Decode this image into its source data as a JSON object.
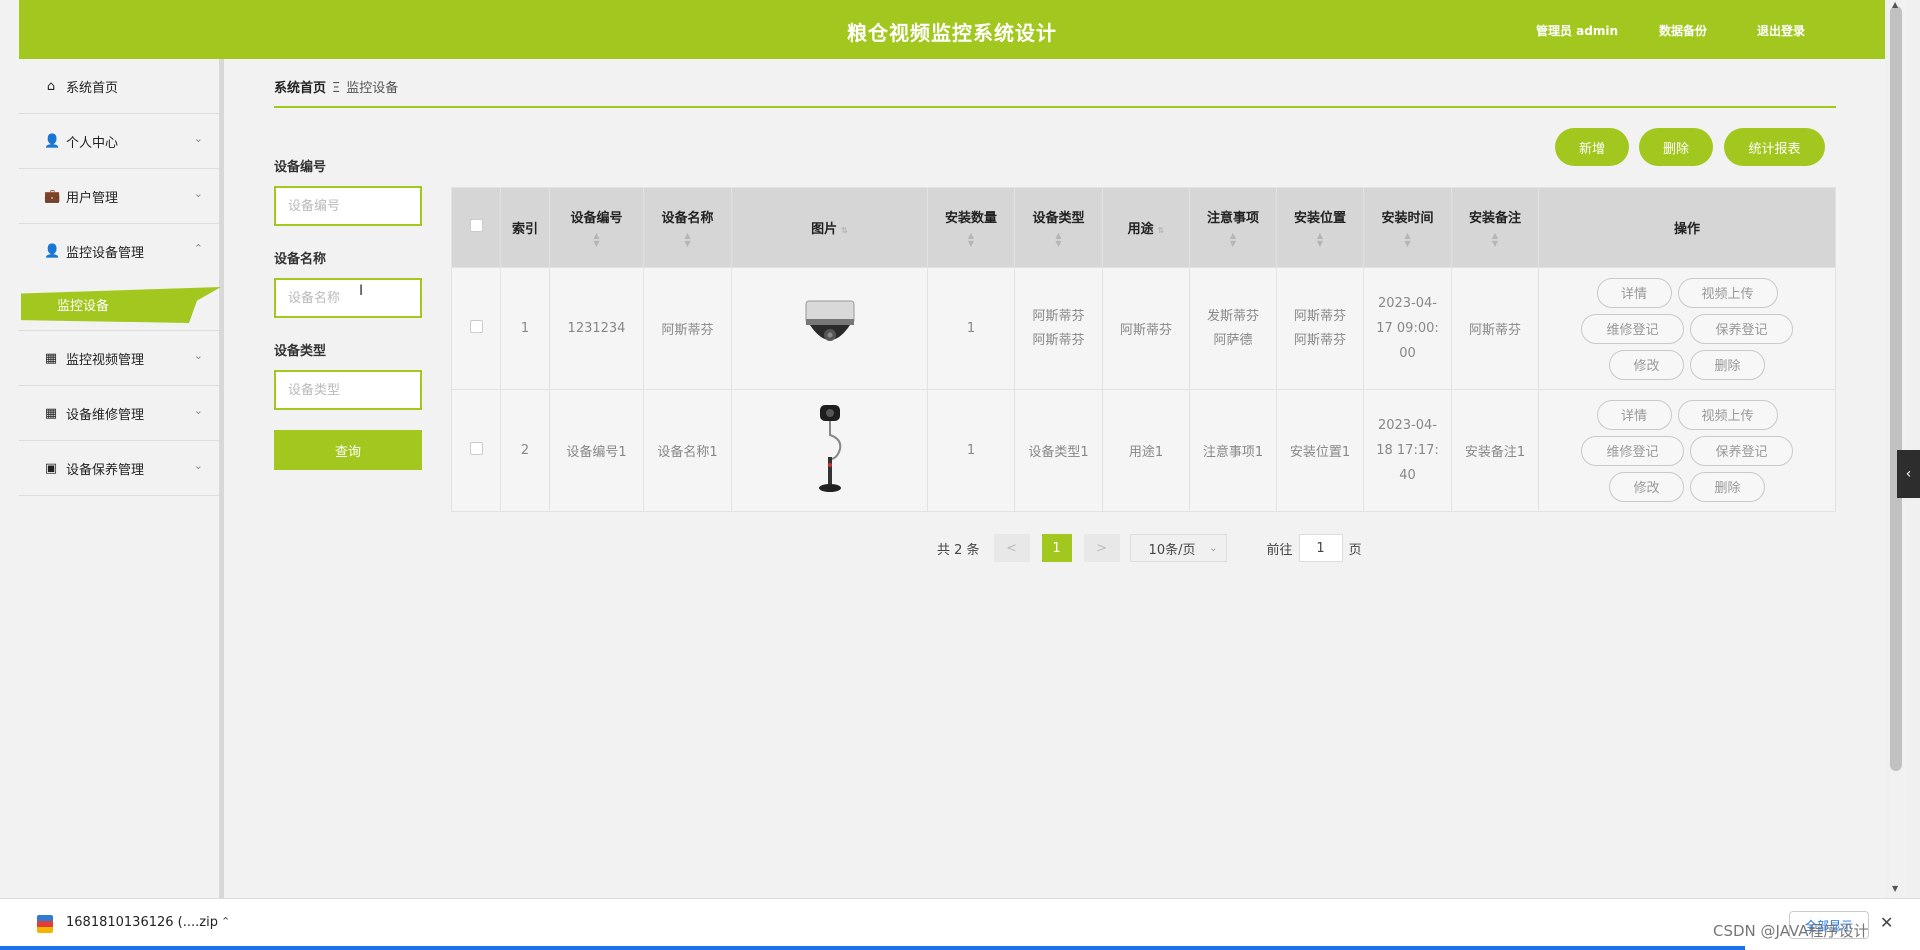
{
  "header": {
    "title": "粮仓视频监控系统设计",
    "admin": "管理员 admin",
    "backup": "数据备份",
    "logout": "退出登录"
  },
  "sidebar": {
    "items": [
      {
        "label": "系统首页",
        "icon": "home-icon"
      },
      {
        "label": "个人中心",
        "icon": "user-icon"
      },
      {
        "label": "用户管理",
        "icon": "briefcase-icon"
      },
      {
        "label": "监控设备管理",
        "icon": "user-icon"
      },
      {
        "label": "监控视频管理",
        "icon": "grid-icon"
      },
      {
        "label": "设备维修管理",
        "icon": "grid-icon"
      },
      {
        "label": "设备保养管理",
        "icon": "wallet-icon"
      }
    ],
    "sub_item": "监控设备"
  },
  "breadcrumb": {
    "home": "系统首页",
    "separator": "Ξ",
    "current": "监控设备"
  },
  "search": {
    "field1_label": "设备编号",
    "field1_placeholder": "设备编号",
    "field2_label": "设备名称",
    "field2_placeholder": "设备名称",
    "field3_label": "设备类型",
    "field3_placeholder": "设备类型",
    "query": "查询"
  },
  "actions": {
    "add": "新增",
    "delete": "删除",
    "report": "统计报表"
  },
  "table": {
    "headers": [
      "索引",
      "设备编号",
      "设备名称",
      "图片",
      "安装数量",
      "设备类型",
      "用途",
      "注意事项",
      "安装位置",
      "安装时间",
      "安装备注",
      "操作"
    ],
    "rows": [
      {
        "index": "1",
        "code": "1231234",
        "name": "阿斯蒂芬",
        "image": "dome-camera",
        "qty": "1",
        "type": [
          "阿斯蒂芬",
          "阿斯蒂芬"
        ],
        "use": "阿斯蒂芬",
        "notes": [
          "发斯蒂芬",
          "阿萨德"
        ],
        "loc": [
          "阿斯蒂芬",
          "阿斯蒂芬"
        ],
        "time": [
          "2023-04-",
          "17 09:00:",
          "00"
        ],
        "remark": "阿斯蒂芬"
      },
      {
        "index": "2",
        "code": "设备编号1",
        "name": "设备名称1",
        "image": "webcam-stand",
        "qty": "1",
        "type": [
          "设备类型1"
        ],
        "use": "用途1",
        "notes": [
          "注意事项1"
        ],
        "loc": [
          "安装位置1"
        ],
        "time": [
          "2023-04-",
          "18 17:17:",
          "40"
        ],
        "remark": "安装备注1"
      }
    ],
    "row_buttons": {
      "detail": "详情",
      "upload": "视频上传",
      "repair": "维修登记",
      "maint": "保养登记",
      "edit": "修改",
      "del": "删除"
    }
  },
  "pager": {
    "total": "共 2 条",
    "prev": "<",
    "page": "1",
    "next": ">",
    "size": "10条/页",
    "goto": "前往",
    "goto_value": "1",
    "page_unit": "页"
  },
  "download": {
    "file": "1681810136126 (....zip",
    "show_all": "全部显示"
  },
  "watermark": "CSDN @JAVA程序设计",
  "colors": {
    "accent": "#a2c81f"
  }
}
